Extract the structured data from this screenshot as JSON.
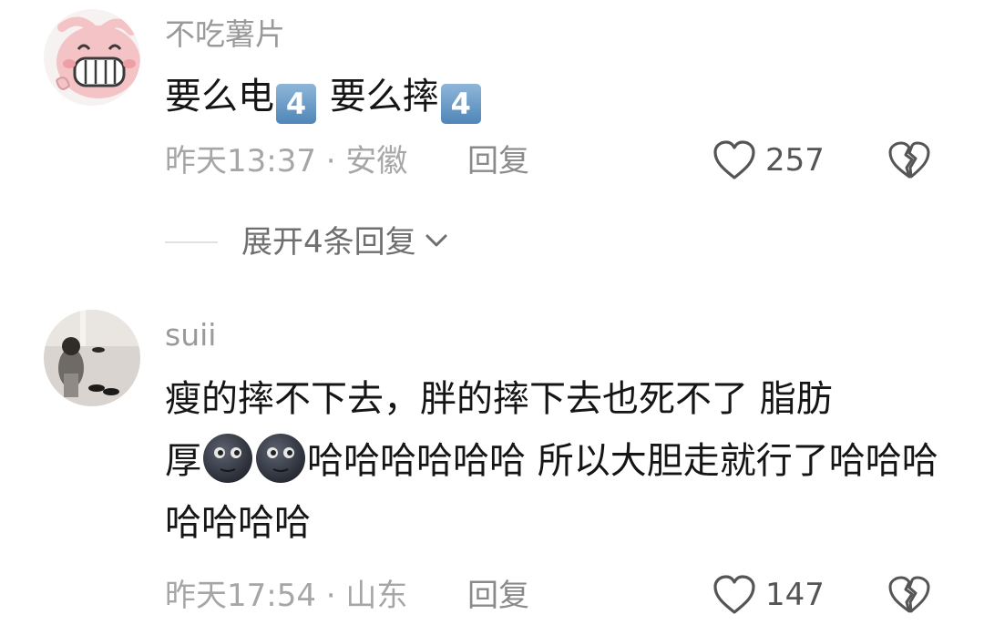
{
  "comments": [
    {
      "username": "不吃薯片",
      "text_before": "要么电",
      "emoji_1": "4",
      "text_middle": " 要么摔",
      "emoji_2": "4",
      "time": "昨天13:37",
      "separator": " · ",
      "location": "安徽",
      "reply_label": "回复",
      "like_count": "257",
      "expand_label": "展开4条回复"
    },
    {
      "username": "suii",
      "text_line_1": "瘦的摔不下去，胖的摔下去也死不了 脂肪",
      "text_prefix": "厚",
      "text_after_emoji": "哈哈哈哈哈哈 所以大胆走就行了哈哈哈哈哈哈哈",
      "time": "昨天17:54",
      "separator": " · ",
      "location": "山东",
      "reply_label": "回复",
      "like_count": "147"
    }
  ],
  "icons": {
    "like": "heart-outline-icon",
    "dislike": "broken-heart-icon",
    "expand": "chevron-down-icon",
    "emoji_keycap": "keycap-four-emoji",
    "emoji_moon": "new-moon-face-emoji"
  },
  "colors": {
    "meta_text": "#a6a6a6",
    "username_text": "#9a9a9a",
    "body_text": "#151515",
    "keycap_blue": "#5b8fc1"
  }
}
